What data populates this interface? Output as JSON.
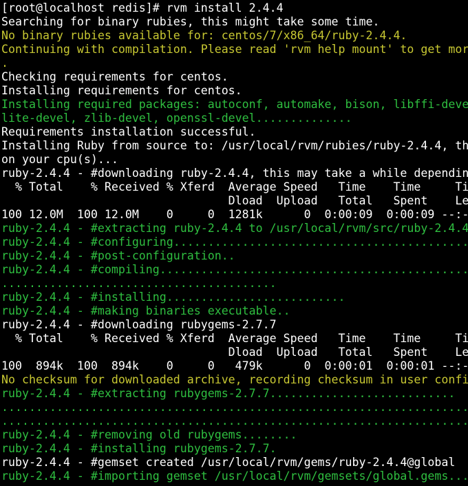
{
  "terminal": {
    "lines": [
      {
        "text": "[root@localhost redis]# rvm install 2.4.4",
        "color": "white"
      },
      {
        "text": "Searching for binary rubies, this might take some time.",
        "color": "white"
      },
      {
        "text": "No binary rubies available for: centos/7/x86_64/ruby-2.4.4.",
        "color": "yellow"
      },
      {
        "text": "Continuing with compilation. Please read 'rvm help mount' to get mor",
        "color": "yellow"
      },
      {
        "text": ".",
        "color": "yellow"
      },
      {
        "text": "Checking requirements for centos.",
        "color": "white"
      },
      {
        "text": "Installing requirements for centos.",
        "color": "white"
      },
      {
        "text": "Installing required packages: autoconf, automake, bison, libffi-deve",
        "color": "green"
      },
      {
        "text": "lite-devel, zlib-devel, openssl-devel..............",
        "color": "green"
      },
      {
        "text": "Requirements installation successful.",
        "color": "white"
      },
      {
        "text": "Installing Ruby from source to: /usr/local/rvm/rubies/ruby-2.4.4, th",
        "color": "white"
      },
      {
        "text": "on your cpu(s)...",
        "color": "white"
      },
      {
        "text": "ruby-2.4.4 - #downloading ruby-2.4.4, this may take a while dependin",
        "color": "white"
      },
      {
        "text": "  % Total    % Received % Xferd  Average Speed   Time    Time     Ti",
        "color": "white"
      },
      {
        "text": "                                 Dload  Upload   Total   Spent    Le",
        "color": "white"
      },
      {
        "text": "100 12.0M  100 12.0M    0     0  1281k      0  0:00:09  0:00:09 --:-",
        "color": "white"
      },
      {
        "text": "ruby-2.4.4 - #extracting ruby-2.4.4 to /usr/local/rvm/src/ruby-2.4.4",
        "color": "green"
      },
      {
        "text": "ruby-2.4.4 - #configuring...........................................",
        "color": "green"
      },
      {
        "text": "ruby-2.4.4 - #post-configuration..",
        "color": "green"
      },
      {
        "text": "ruby-2.4.4 - #compiling.............................................",
        "color": "green"
      },
      {
        "text": "........................................",
        "color": "green"
      },
      {
        "text": "ruby-2.4.4 - #installing..........................",
        "color": "green"
      },
      {
        "text": "ruby-2.4.4 - #making binaries executable..",
        "color": "green"
      },
      {
        "text": "ruby-2.4.4 - #downloading rubygems-2.7.7",
        "color": "white"
      },
      {
        "text": "  % Total    % Received % Xferd  Average Speed   Time    Time     Ti",
        "color": "white"
      },
      {
        "text": "                                 Dload  Upload   Total   Spent    Le",
        "color": "white"
      },
      {
        "text": "100  894k  100  894k    0     0   479k      0  0:00:01  0:00:01 --:-",
        "color": "white"
      },
      {
        "text": "No checksum for downloaded archive, recording checksum in user confi",
        "color": "yellow"
      },
      {
        "text": "ruby-2.4.4 - #extracting rubygems-2.7.7...........................",
        "color": "green"
      },
      {
        "text": "....................................................................",
        "color": "green"
      },
      {
        "text": "....................................................................",
        "color": "green"
      },
      {
        "text": "ruby-2.4.4 - #removing old rubygems........",
        "color": "green"
      },
      {
        "text": "ruby-2.4.4 - #installing rubygems-2.7.7.",
        "color": "green"
      },
      {
        "text": "ruby-2.4.4 - #gemset created /usr/local/rvm/gems/ruby-2.4.4@global",
        "color": "white"
      },
      {
        "text": "ruby-2.4.4 - #importing gemset /usr/local/rvm/gemsets/global.gems...",
        "color": "green"
      }
    ],
    "colors": {
      "background": "#000000",
      "white": "#ffffff",
      "green": "#2fbf40",
      "yellow": "#c8c832"
    }
  }
}
